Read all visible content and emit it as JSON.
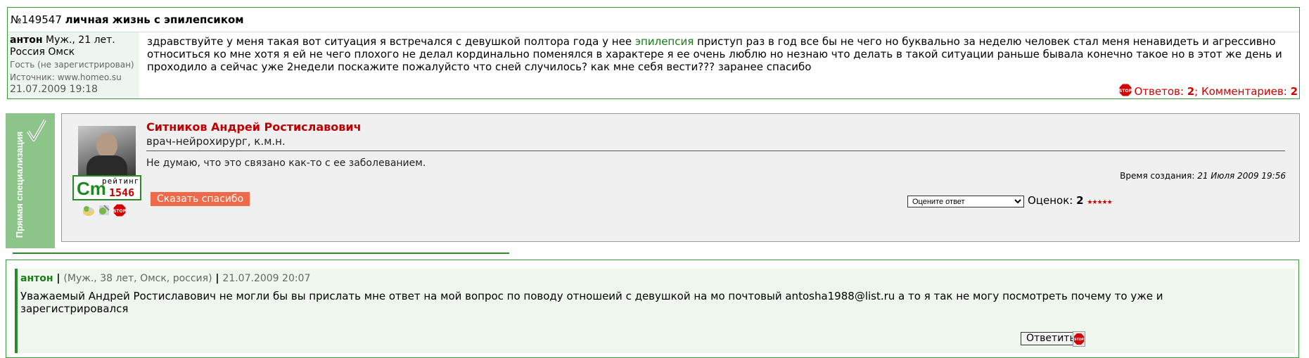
{
  "question": {
    "number": "№149547",
    "title": "личная жизнь с эпилепсиком",
    "author": {
      "name": "антон",
      "info": "Муж., 21 лет.",
      "location": "Россия Омск",
      "status": "Гость (не зарегистрирован)",
      "source": "Источник: www.homeo.su",
      "date": "21.07.2009 19:18"
    },
    "text_before": "здравствуйте у меня такая вот ситуация я встречался с девушкой полтора года у нее ",
    "link_text": "эпилепсия",
    "text_after": " приступ раз в год все бы не чего но буквально за неделю человек стал меня ненавидеть и агрессивно относиться ко мне хотя я ей не чего плохого не делал кординально поменялся в характере я ее очень люблю но незнаю что делать в такой ситуации раньше бывала конечно такое но в этот же день и проходило а сейчас уже 2недели поскажите пожалуйсто что сней случилось? как мне себя вести??? заранее спасибо",
    "stats": {
      "answers_label": "Ответов: ",
      "answers": "2",
      "sep": "; Комментариев: ",
      "comments": "2"
    }
  },
  "answer": {
    "spec_label": "Прямая специализация",
    "doctor_name": "Ситников Андрей Ростиславович",
    "doctor_title": "врач-нейрохирург, к.м.н.",
    "text": "Не думаю, что это связано как-то с ее заболеванием.",
    "rating": {
      "logo": "Cm",
      "caption": "рейтинг",
      "value": "1546"
    },
    "created_label": "Время создания: ",
    "created_value": "21 Июля 2009 19:56",
    "thanks_button": "Сказать спасибо",
    "rate_select": "Оцените ответ",
    "score_label": "Оценок: ",
    "score_value": "2",
    "stars": "★★★★★",
    "colors": {
      "name": "#c00000",
      "button": "#ef6a4a",
      "tab": "#8dc48a"
    }
  },
  "comment": {
    "author": "антон",
    "sep": " | ",
    "info": "(Муж., 38 лет, Омск, россия)",
    "date": "21.07.2009 20:07",
    "text": "Уважаемый Андрей Ростиславович не могли бы вы прислать мне ответ на мой вопрос по поводу отношеий с девушкой на мо почтовый antosha1988@list.ru а то я так не могу посмотреть почему то уже и зарегистрировался",
    "reply_button": "Ответить"
  },
  "icons": [
    "stop-icon",
    "checkmark-icon",
    "award-icon-1",
    "award-icon-2"
  ]
}
